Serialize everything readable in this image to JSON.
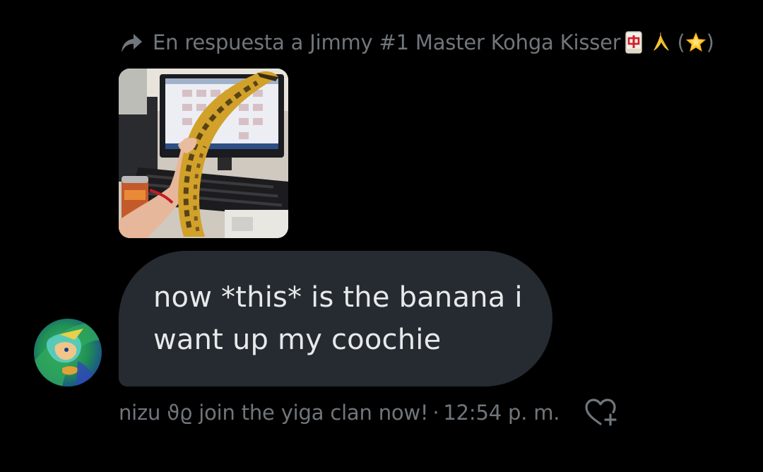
{
  "reply": {
    "prefix": "En respuesta a Jimmy #1 Master Kohga Kisser",
    "paren_open": "(",
    "paren_close": ")",
    "icon": "reply-arrow-icon",
    "emojis": [
      "mahjong-red-dragon",
      "banana",
      "glowing-star"
    ]
  },
  "attachment": {
    "type": "photo",
    "description_icon": "image-thumbnail"
  },
  "message": {
    "lines": [
      "now *this* is the banana i",
      "want up my coochie"
    ]
  },
  "meta": {
    "sender": "nizu ϑϱ join the yiga clan now!",
    "separator": "·",
    "time": "12:54 p. m."
  },
  "colors": {
    "background": "#000000",
    "bubble": "#252b31",
    "text": "#e7e9ea",
    "muted": "#71767b"
  },
  "icons": {
    "react": "heart-plus-icon",
    "reply": "reply-arrow-icon"
  }
}
